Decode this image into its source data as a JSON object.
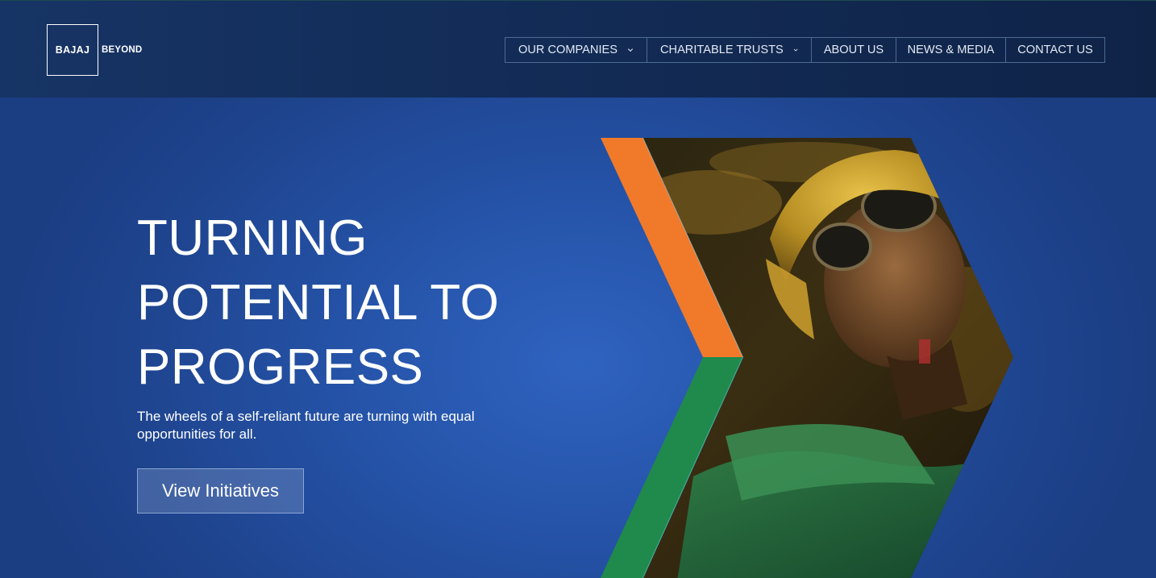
{
  "logo": {
    "brand": "BAJAJ",
    "tagline": "BEYOND"
  },
  "nav": {
    "items": [
      {
        "label": "OUR COMPANIES",
        "has_dropdown": true
      },
      {
        "label": "CHARITABLE TRUSTS",
        "has_dropdown": true
      },
      {
        "label": "ABOUT US",
        "has_dropdown": false
      },
      {
        "label": "NEWS & MEDIA",
        "has_dropdown": false
      },
      {
        "label": "CONTACT US",
        "has_dropdown": false
      }
    ]
  },
  "hero": {
    "headline_lines": [
      "TURNING",
      "POTENTIAL TO",
      "PROGRESS"
    ],
    "subtext": "The wheels of a self-reliant future are turning with equal opportunities for all.",
    "cta_label": "View Initiatives",
    "image_icon": "worker-photo"
  },
  "colors": {
    "header_bg": "#132c57",
    "hero_bg": "#2553a8",
    "accent_orange": "#f07a2a",
    "accent_green": "#1f8a4c",
    "text": "#ffffff"
  }
}
